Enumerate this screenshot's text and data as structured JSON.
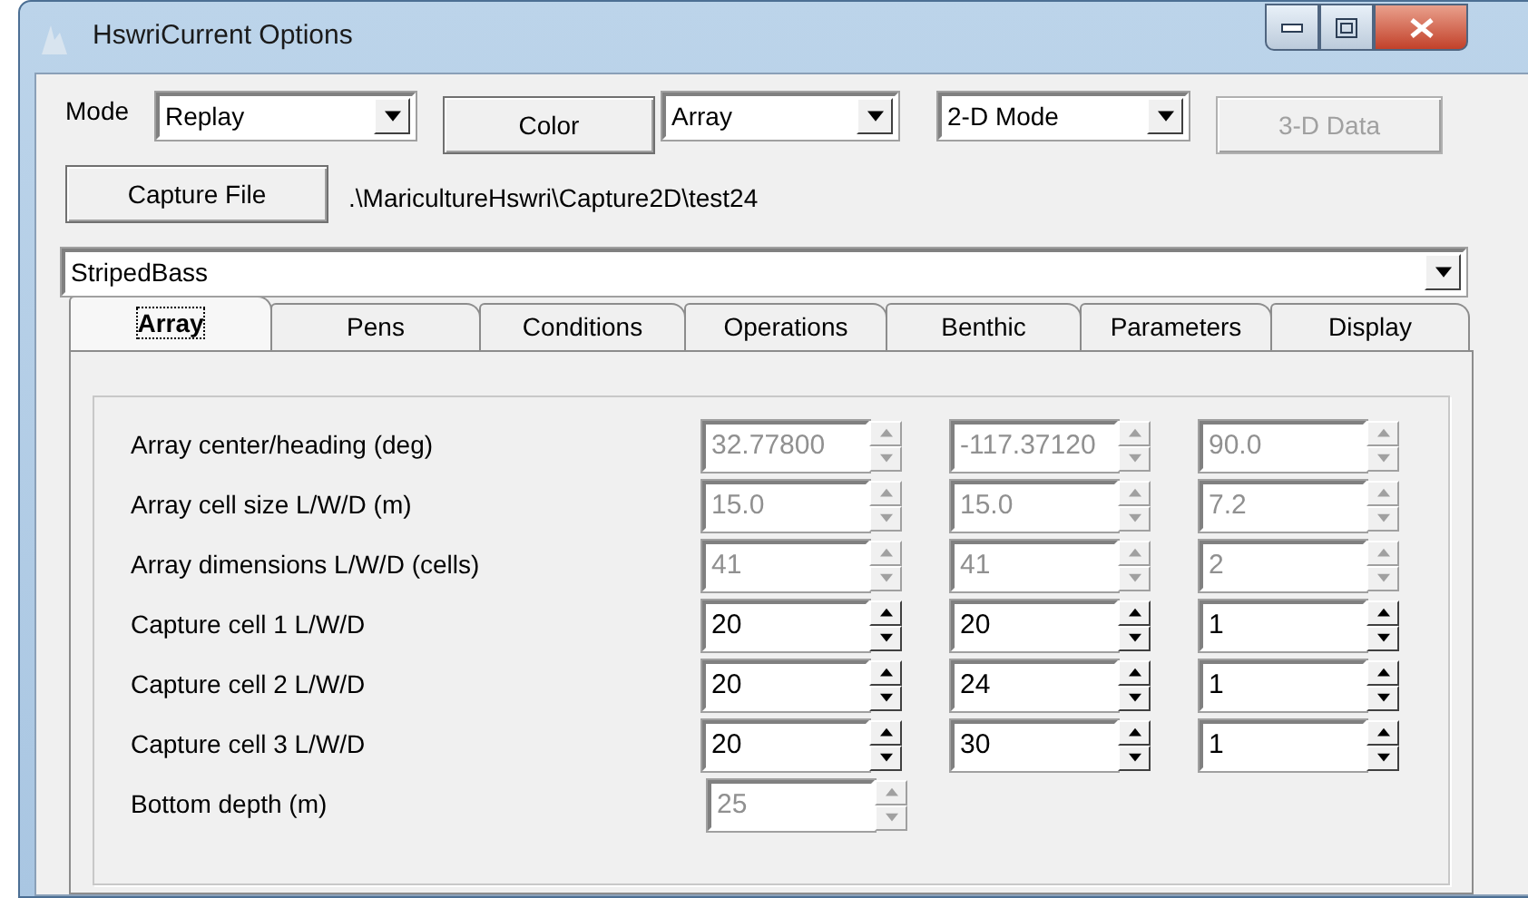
{
  "window": {
    "title": "HswriCurrent Options"
  },
  "toolbar": {
    "mode_label": "Mode",
    "mode_combo": {
      "value": "Replay"
    },
    "color_button": {
      "label": "Color",
      "disabled": false
    },
    "view_combo": {
      "value": "Array"
    },
    "dimension_combo": {
      "value": "2-D Mode"
    },
    "data3d_button": {
      "label": "3-D Data",
      "disabled": true
    },
    "capture_button": {
      "label": "Capture File",
      "disabled": false
    },
    "capture_path": ".\\MaricultureHswri\\Capture2D\\test24"
  },
  "species_combo": {
    "value": "StripedBass"
  },
  "tabs": [
    {
      "label": "Array",
      "selected": true
    },
    {
      "label": "Pens",
      "selected": false
    },
    {
      "label": "Conditions",
      "selected": false
    },
    {
      "label": "Operations",
      "selected": false
    },
    {
      "label": "Benthic",
      "selected": false
    },
    {
      "label": "Parameters",
      "selected": false
    },
    {
      "label": "Display",
      "selected": false
    }
  ],
  "array_panel": {
    "rows": [
      {
        "label": "Array center/heading (deg)",
        "fields": [
          {
            "value": "32.77800",
            "disabled": true
          },
          {
            "value": "-117.37120",
            "disabled": true
          },
          {
            "value": "90.0",
            "disabled": true
          }
        ]
      },
      {
        "label": "Array cell size L/W/D (m)",
        "fields": [
          {
            "value": "15.0",
            "disabled": true
          },
          {
            "value": "15.0",
            "disabled": true
          },
          {
            "value": "7.2",
            "disabled": true
          }
        ]
      },
      {
        "label": "Array dimensions L/W/D (cells)",
        "fields": [
          {
            "value": "41",
            "disabled": true
          },
          {
            "value": "41",
            "disabled": true
          },
          {
            "value": "2",
            "disabled": true
          }
        ]
      },
      {
        "label": "Capture cell 1 L/W/D",
        "fields": [
          {
            "value": "20",
            "disabled": false
          },
          {
            "value": "20",
            "disabled": false
          },
          {
            "value": "1",
            "disabled": false
          }
        ]
      },
      {
        "label": "Capture cell 2 L/W/D",
        "fields": [
          {
            "value": "20",
            "disabled": false
          },
          {
            "value": "24",
            "disabled": false
          },
          {
            "value": "1",
            "disabled": false
          }
        ]
      },
      {
        "label": "Capture cell 3 L/W/D",
        "fields": [
          {
            "value": "20",
            "disabled": false
          },
          {
            "value": "30",
            "disabled": false
          },
          {
            "value": "1",
            "disabled": false
          }
        ]
      },
      {
        "label": "Bottom depth (m)",
        "fields": [
          {
            "value": "25",
            "disabled": true
          }
        ]
      }
    ]
  }
}
